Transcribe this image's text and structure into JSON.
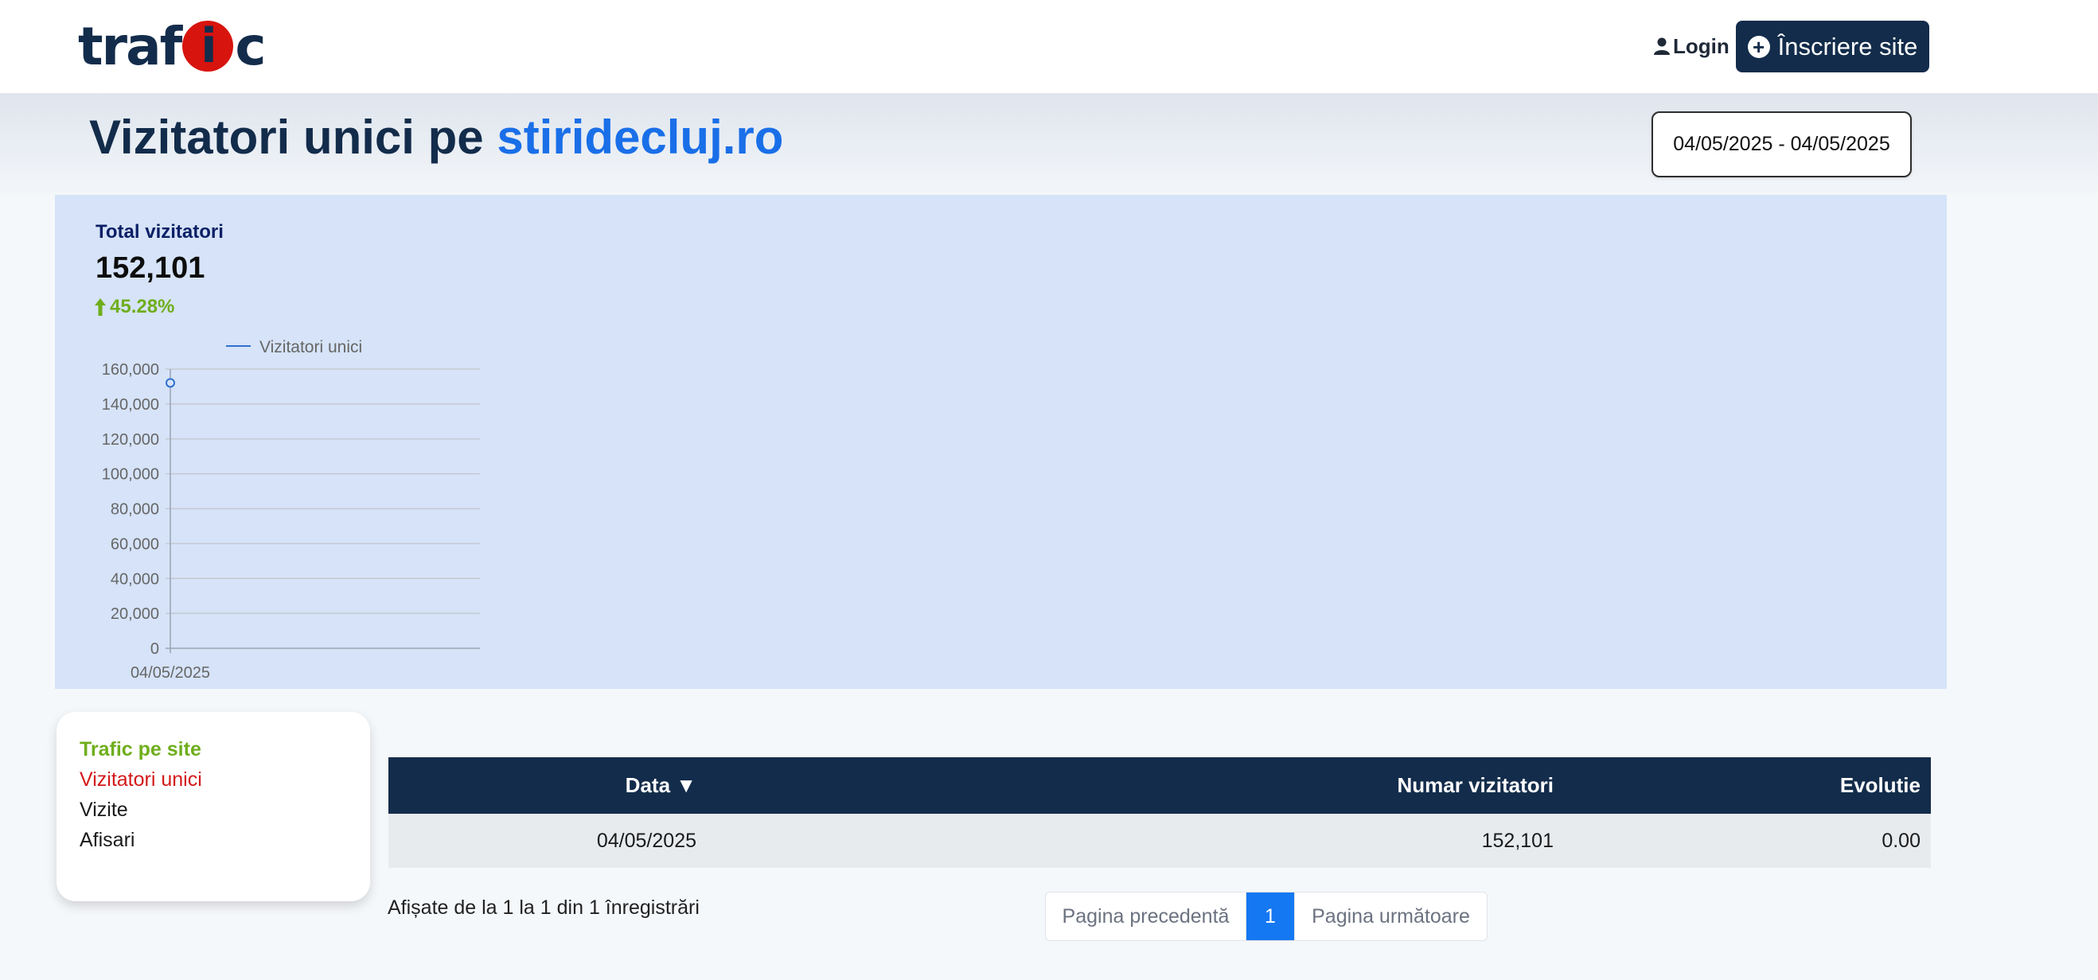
{
  "header": {
    "logo": {
      "pre": "traf",
      "i": "i",
      "post": "c"
    },
    "login_label": "Login",
    "signup_label": "Înscriere site"
  },
  "title": {
    "prefix": "Vizitatori unici pe",
    "site": "stiridecluj.ro"
  },
  "date_range": "04/05/2025 - 04/05/2025",
  "stats": {
    "total_label": "Total vizitatori",
    "total_value": "152,101",
    "growth": "45.28%"
  },
  "chart_data": {
    "type": "line",
    "categories": [
      "04/05/2025"
    ],
    "series": [
      {
        "name": "Vizitatori unici",
        "values": [
          152101
        ],
        "color": "#2f6fd0"
      }
    ],
    "ylim": [
      0,
      160000
    ],
    "yticks": [
      "0",
      "20,000",
      "40,000",
      "60,000",
      "80,000",
      "100,000",
      "120,000",
      "140,000",
      "160,000"
    ],
    "grid": true,
    "legend": "top"
  },
  "menu": {
    "items": [
      {
        "label": "Trafic pe site"
      },
      {
        "label": "Vizitatori unici"
      },
      {
        "label": "Vizite"
      },
      {
        "label": "Afisari"
      }
    ]
  },
  "table": {
    "headers": {
      "date": "Data",
      "sort_icon": "▼",
      "visitors": "Numar vizitatori",
      "evolution": "Evolutie"
    },
    "rows": [
      {
        "date": "04/05/2025",
        "visitors": "152,101",
        "evolution": "0.00"
      }
    ],
    "info": "Afișate de la 1 la 1 din 1 înregistrări"
  },
  "pagination": {
    "prev": "Pagina precedentă",
    "current": "1",
    "next": "Pagina următoare"
  },
  "colors": {
    "navy": "#132c4b",
    "accent_blue": "#1a6fe8",
    "panel": "#d6e3f8",
    "green": "#6fae1c",
    "red": "#d31919"
  }
}
